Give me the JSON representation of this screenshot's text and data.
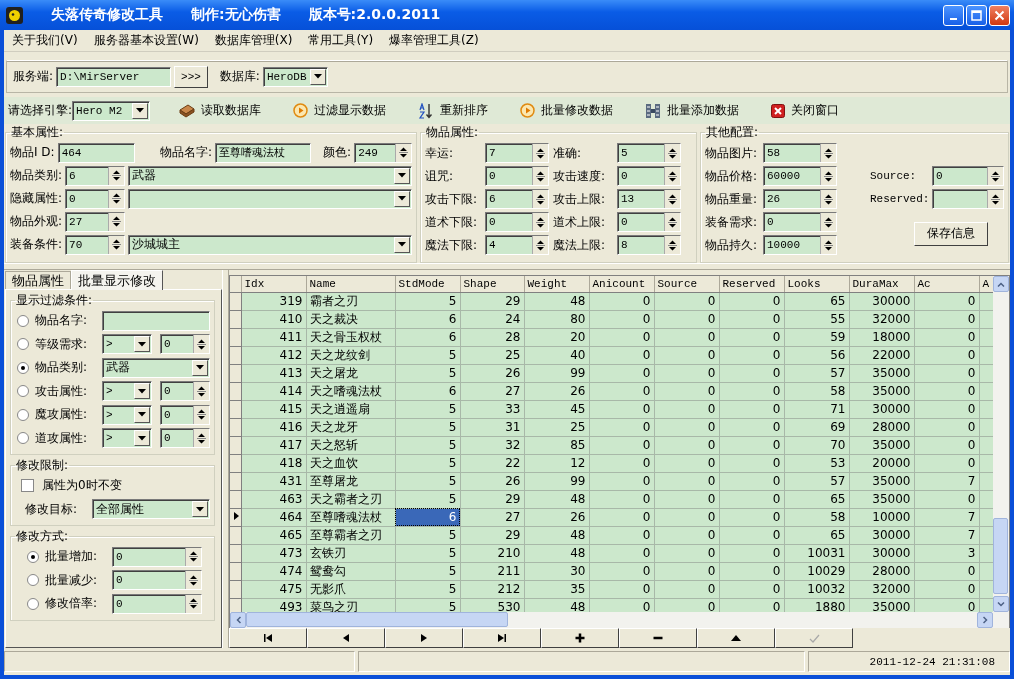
{
  "window": {
    "title": "失落传奇修改工具",
    "author": "制作:无心伤害",
    "version": "版本号:2.0.0.2011"
  },
  "menu": [
    "关于我们(V)",
    "服务器基本设置(W)",
    "数据库管理(X)",
    "常用工具(Y)",
    "爆率管理工具(Z)"
  ],
  "server_bar": {
    "server_label": "服务端:",
    "server_value": "D:\\MirServer",
    "browse_button": ">>>",
    "database_label": "数据库:",
    "database_value": "HeroDB"
  },
  "toolbar": {
    "engine_label": "请选择引擎:",
    "engine_value": "Hero M2",
    "buttons": [
      {
        "label": "读取数据库",
        "kind": "book"
      },
      {
        "label": "过滤显示数据",
        "kind": "play"
      },
      {
        "label": "重新排序",
        "kind": "sort"
      },
      {
        "label": "批量修改数据",
        "kind": "play"
      },
      {
        "label": "批量添加数据",
        "kind": "grid"
      },
      {
        "label": "关闭窗口",
        "kind": "close"
      }
    ]
  },
  "basic": {
    "title": "基本属性:",
    "id": {
      "label": "物品I D:",
      "value": "464"
    },
    "name": {
      "label": "物品名字:",
      "value": "至尊嗜魂法杖"
    },
    "color": {
      "label": "颜色:",
      "value": "249"
    },
    "rows": [
      {
        "label": "物品类别:",
        "value": "6",
        "kind": "spin_combo",
        "combo": "武器"
      },
      {
        "label": "隐藏属性:",
        "value": "0",
        "kind": "spin_combo"
      },
      {
        "label": "物品外观:",
        "value": "27",
        "kind": "spin"
      },
      {
        "label": "装备条件:",
        "value": "70",
        "kind": "spin_combo",
        "combo": "沙城城主"
      }
    ]
  },
  "item_props": {
    "title": "物品属性:",
    "fields": [
      {
        "label": "幸运:",
        "value": "7"
      },
      {
        "label": "准确:",
        "value": "5"
      },
      {
        "label": "诅咒:",
        "value": "0"
      },
      {
        "label": "攻击速度:",
        "value": "0"
      },
      {
        "label": "攻击下限:",
        "value": "6"
      },
      {
        "label": "攻击上限:",
        "value": "13"
      },
      {
        "label": "道术下限:",
        "value": "0"
      },
      {
        "label": "道术上限:",
        "value": "0"
      },
      {
        "label": "魔法下限:",
        "value": "4"
      },
      {
        "label": "魔法上限:",
        "value": "8"
      }
    ]
  },
  "other": {
    "title": "其他配置:",
    "fields": [
      {
        "label": "物品图片:",
        "value": "58"
      },
      {
        "label": "物品价格:",
        "value": "60000"
      },
      {
        "label": "物品重量:",
        "value": "26"
      },
      {
        "label": "装备需求:",
        "value": "0"
      },
      {
        "label": "物品持久:",
        "value": "10000"
      }
    ],
    "extra": [
      {
        "label": "Source:",
        "value": "0"
      },
      {
        "label": "Reserved:"
      }
    ],
    "save_button": "保存信息"
  },
  "left_tabs": [
    {
      "label": "物品属性",
      "selected": false
    },
    {
      "label": "批量显示修改",
      "selected": true
    }
  ],
  "filter": {
    "title": "显示过滤条件:",
    "rows": [
      {
        "kind": "text",
        "label": "物品名字:",
        "selected": false
      },
      {
        "kind": "compare",
        "label": "等级需求:",
        "operator": ">",
        "value": "0",
        "selected": false
      },
      {
        "kind": "combo",
        "label": "物品类别:",
        "value": "武器",
        "selected": true
      },
      {
        "kind": "compare",
        "label": "攻击属性:",
        "operator": ">",
        "value": "0",
        "selected": false
      },
      {
        "kind": "compare",
        "label": "魔攻属性:",
        "operator": ">",
        "value": "0",
        "selected": false
      },
      {
        "kind": "compare",
        "label": "道攻属性:",
        "operator": ">",
        "value": "0",
        "selected": false
      }
    ]
  },
  "limit": {
    "title": "修改限制:",
    "checkbox": {
      "label": "属性为0时不变",
      "checked": false
    },
    "target": {
      "label": "修改目标:",
      "value": "全部属性"
    }
  },
  "mode": {
    "title": "修改方式:",
    "rows": [
      {
        "label": "批量增加:",
        "value": "0",
        "selected": true
      },
      {
        "label": "批量减少:",
        "value": "0",
        "selected": false
      },
      {
        "label": "修改倍率:",
        "value": "0",
        "selected": false
      }
    ]
  },
  "table": {
    "columns": [
      "Idx",
      "Name",
      "StdMode",
      "Shape",
      "Weight",
      "Anicount",
      "Source",
      "Reserved",
      "Looks",
      "DuraMax",
      "Ac",
      "A"
    ],
    "rows": [
      {
        "selected": false,
        "cells": [
          "319",
          "霸者之刃",
          "5",
          "29",
          "48",
          "0",
          "0",
          "0",
          "65",
          "30000",
          "0"
        ]
      },
      {
        "selected": false,
        "cells": [
          "410",
          "天之裁决",
          "6",
          "24",
          "80",
          "0",
          "0",
          "0",
          "55",
          "32000",
          "0"
        ]
      },
      {
        "selected": false,
        "cells": [
          "411",
          "天之骨玉权杖",
          "6",
          "28",
          "20",
          "0",
          "0",
          "0",
          "59",
          "18000",
          "0"
        ]
      },
      {
        "selected": false,
        "cells": [
          "412",
          "天之龙纹剑",
          "5",
          "25",
          "40",
          "0",
          "0",
          "0",
          "56",
          "22000",
          "0"
        ]
      },
      {
        "selected": false,
        "cells": [
          "413",
          "天之屠龙",
          "5",
          "26",
          "99",
          "0",
          "0",
          "0",
          "57",
          "35000",
          "0"
        ]
      },
      {
        "selected": false,
        "cells": [
          "414",
          "天之嗜魂法杖",
          "6",
          "27",
          "26",
          "0",
          "0",
          "0",
          "58",
          "35000",
          "0"
        ]
      },
      {
        "selected": false,
        "cells": [
          "415",
          "天之逍遥扇",
          "5",
          "33",
          "45",
          "0",
          "0",
          "0",
          "71",
          "30000",
          "0"
        ]
      },
      {
        "selected": false,
        "cells": [
          "416",
          "天之龙牙",
          "5",
          "31",
          "25",
          "0",
          "0",
          "0",
          "69",
          "28000",
          "0"
        ]
      },
      {
        "selected": false,
        "cells": [
          "417",
          "天之怒斩",
          "5",
          "32",
          "85",
          "0",
          "0",
          "0",
          "70",
          "35000",
          "0"
        ]
      },
      {
        "selected": false,
        "cells": [
          "418",
          "天之血饮",
          "5",
          "22",
          "12",
          "0",
          "0",
          "0",
          "53",
          "20000",
          "0"
        ]
      },
      {
        "selected": false,
        "cells": [
          "431",
          "至尊屠龙",
          "5",
          "26",
          "99",
          "0",
          "0",
          "0",
          "57",
          "35000",
          "7"
        ]
      },
      {
        "selected": false,
        "cells": [
          "463",
          "天之霸者之刃",
          "5",
          "29",
          "48",
          "0",
          "0",
          "0",
          "65",
          "35000",
          "0"
        ]
      },
      {
        "selected": true,
        "cells": [
          "464",
          "至尊嗜魂法杖",
          {
            "text": "6",
            "focused": true
          },
          "27",
          "26",
          "0",
          "0",
          "0",
          "58",
          "10000",
          "7"
        ]
      },
      {
        "selected": false,
        "cells": [
          "465",
          "至尊霸者之刃",
          "5",
          "29",
          "48",
          "0",
          "0",
          "0",
          "65",
          "30000",
          "7"
        ]
      },
      {
        "selected": false,
        "cells": [
          "473",
          "玄铁刃",
          "5",
          "210",
          "48",
          "0",
          "0",
          "0",
          "10031",
          "30000",
          "3"
        ]
      },
      {
        "selected": false,
        "cells": [
          "474",
          "鸳鸯勾",
          "5",
          "211",
          "30",
          "0",
          "0",
          "0",
          "10029",
          "28000",
          "0"
        ]
      },
      {
        "selected": false,
        "cells": [
          "475",
          "无影爪",
          "5",
          "212",
          "35",
          "0",
          "0",
          "0",
          "10032",
          "32000",
          "0"
        ]
      },
      {
        "selected": false,
        "cells": [
          "493",
          "菜鸟之刃",
          "5",
          "530",
          "48",
          "0",
          "0",
          "0",
          "1880",
          "35000",
          "0"
        ]
      }
    ]
  },
  "navigator": [
    {
      "kind": "first",
      "disabled": false
    },
    {
      "kind": "prior",
      "disabled": false
    },
    {
      "kind": "next",
      "disabled": false
    },
    {
      "kind": "last",
      "disabled": false
    },
    {
      "kind": "insert",
      "disabled": false
    },
    {
      "kind": "delete",
      "disabled": false
    },
    {
      "kind": "edit",
      "disabled": false
    },
    {
      "kind": "post",
      "disabled": true
    }
  ],
  "status_bar": {
    "datetime": "2011-12-24 21:31:08"
  }
}
